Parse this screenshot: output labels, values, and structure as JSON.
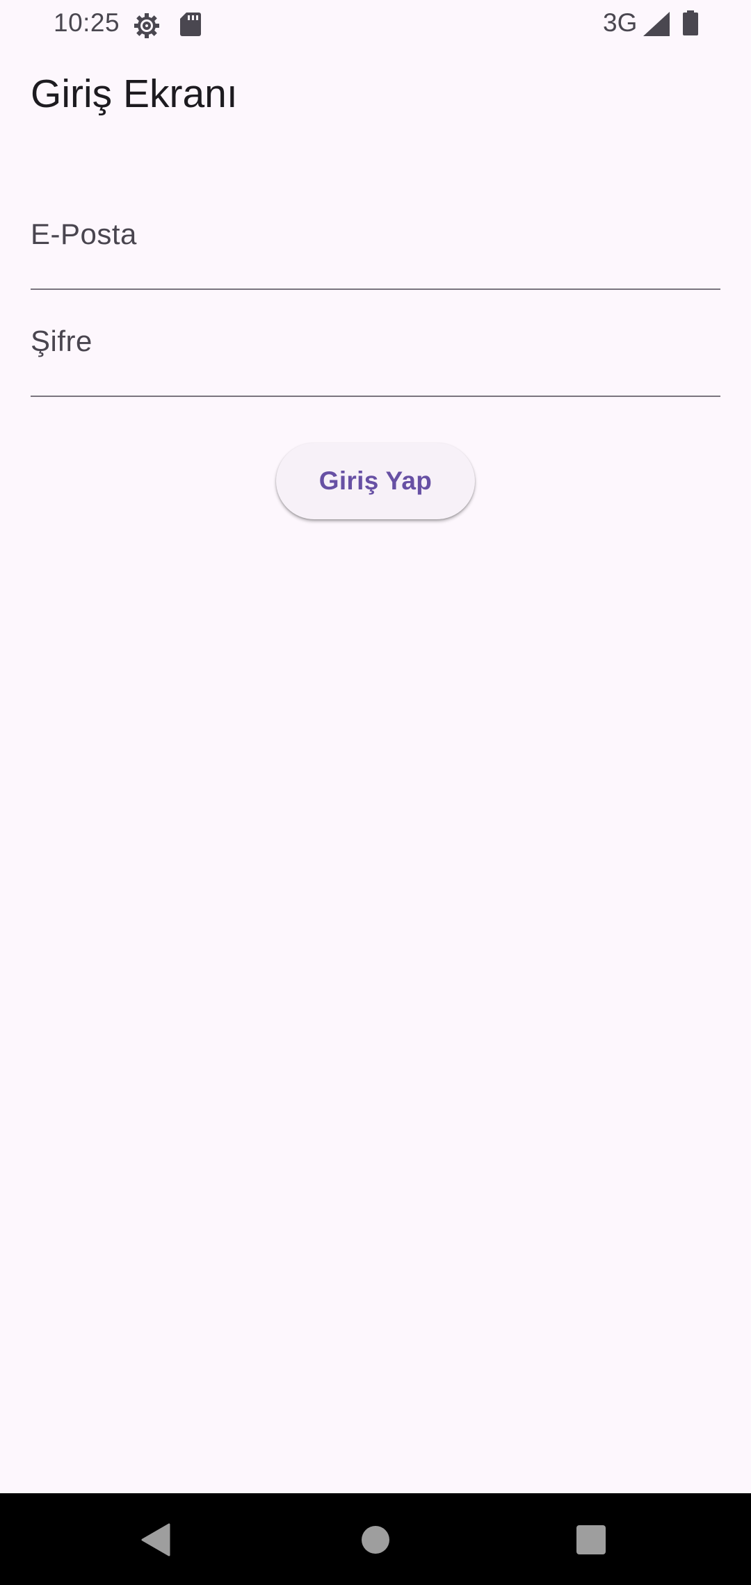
{
  "status_bar": {
    "time": "10:25",
    "network": "3G",
    "icons": [
      "settings-gear-icon",
      "sd-card-icon",
      "signal-icon",
      "battery-icon"
    ]
  },
  "page": {
    "title": "Giriş Ekranı"
  },
  "form": {
    "email_label": "E-Posta",
    "email_value": "",
    "password_label": "Şifre",
    "password_value": "",
    "submit_label": "Giriş Yap"
  },
  "nav_bar": {
    "icons": [
      "back-icon",
      "home-icon",
      "recents-icon"
    ]
  },
  "colors": {
    "background": "#fdf7fd",
    "accent": "#6750a4",
    "text": "#1d1b20",
    "field_line": "#79747e",
    "button_bg": "#f7f1f8"
  }
}
